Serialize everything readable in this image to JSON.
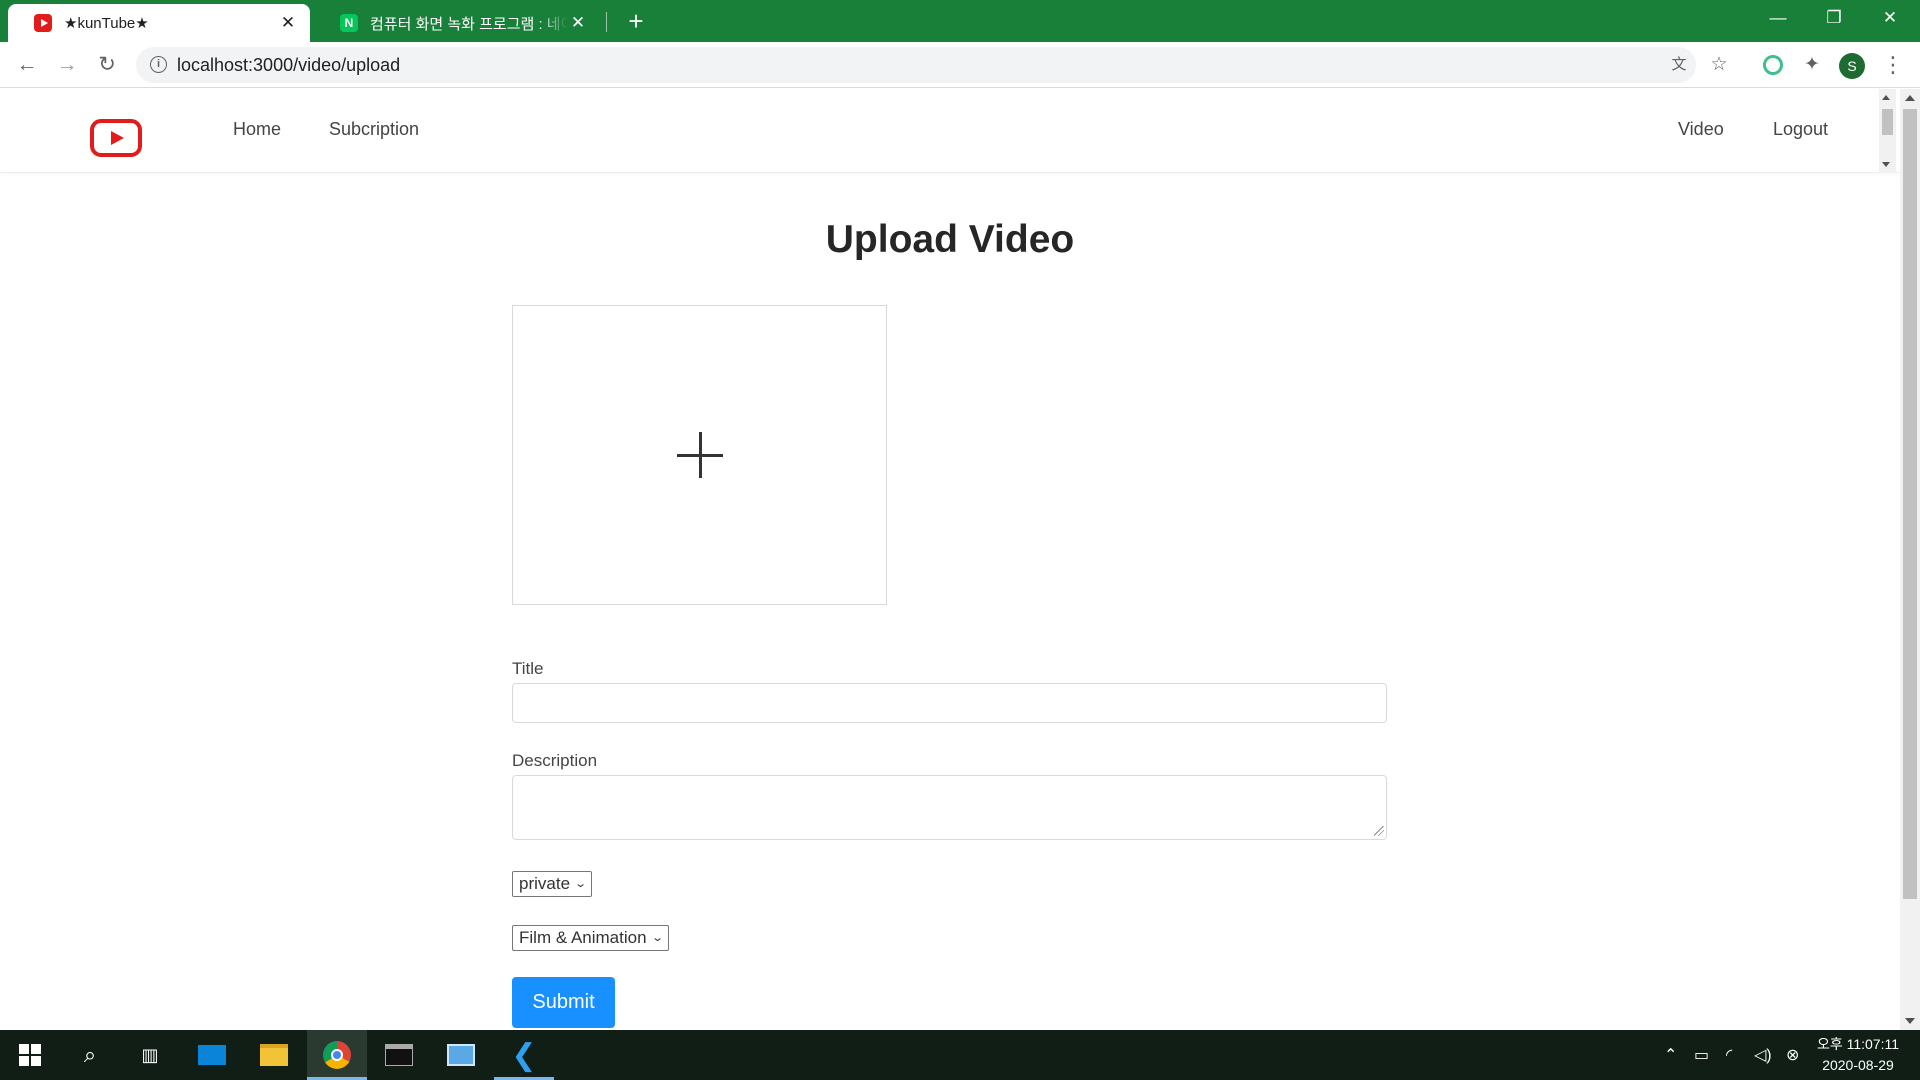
{
  "browser": {
    "tabs": [
      {
        "title": "★kunTube★",
        "close": "✕"
      },
      {
        "title": "컴퓨터 화면 녹화 프로그램 : 네이",
        "favicon_text": "N",
        "close": "✕"
      }
    ],
    "new_tab": "+",
    "window_controls": {
      "minimize": "—",
      "restore": "❐",
      "close": "✕"
    },
    "url": "localhost:3000/video/upload",
    "info_icon": "i",
    "profile_initial": "S"
  },
  "site_nav": {
    "left_links": [
      "Home",
      "Subcription"
    ],
    "right_links": [
      "Video",
      "Logout"
    ]
  },
  "upload": {
    "title": "Upload Video",
    "title_label": "Title",
    "title_value": "",
    "description_label": "Description",
    "description_value": "",
    "privacy_selected": "private",
    "category_selected": "Film & Animation",
    "submit_label": "Submit"
  },
  "taskbar": {
    "clock_time": "오후 11:07:11",
    "clock_date": "2020-08-29"
  },
  "colors": {
    "browser_frame": "#188038",
    "logo_red": "#e21b1b",
    "submit_blue": "#1890ff",
    "taskbar": "#101e16"
  }
}
